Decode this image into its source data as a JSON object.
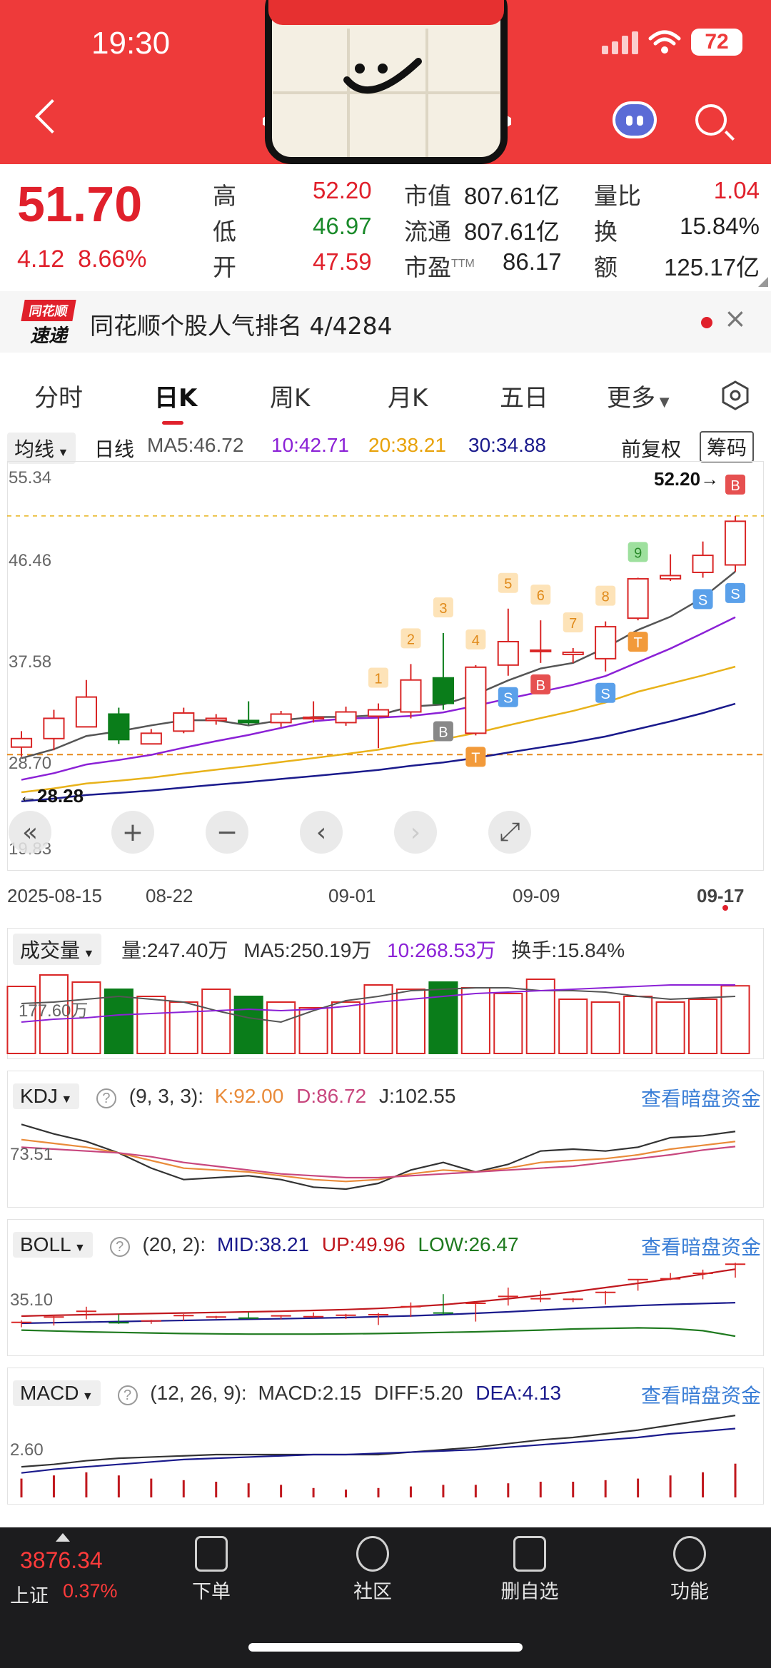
{
  "status_bar": {
    "time": "19:30",
    "battery": "72"
  },
  "quote": {
    "price": "51.70",
    "change": "4.12",
    "change_pct": "8.66%",
    "rows": [
      {
        "l1": "高",
        "v1": "52.20",
        "l2": "市值",
        "v2": "807.61亿",
        "l3": "量比",
        "v3": "1.04"
      },
      {
        "l1": "低",
        "v1": "46.97",
        "l2": "流通",
        "v2": "807.61亿",
        "l3": "换",
        "v3": "15.84%"
      },
      {
        "l1": "开",
        "v1": "47.59",
        "l2": "市盈",
        "v2": "86.17",
        "l3": "额",
        "v3": "125.17亿"
      }
    ],
    "pe_sup": "TTM"
  },
  "banner": {
    "logo_top": "同花顺",
    "logo_bottom": "速递",
    "text": "同花顺个股人气排名 4/4284",
    "close": "×"
  },
  "tabs": [
    "分时",
    "日K",
    "周K",
    "月K",
    "五日",
    "更多"
  ],
  "kline": {
    "selector": "均线",
    "period": "日线",
    "ma5": "MA5:46.72",
    "ma10": "10:42.71",
    "ma20": "20:38.21",
    "ma30": "30:34.88",
    "adjust": "前复权",
    "chips": "筹码",
    "yticks": [
      "55.34",
      "46.46",
      "37.58",
      "28.70",
      "19.83"
    ],
    "high_label": "52.20→",
    "low_label": "←28.28",
    "dates": [
      "2025-08-15",
      "08-22",
      "09-01",
      "09-09",
      "09-17"
    ],
    "nav": [
      "«",
      "+",
      "−",
      "‹",
      "›",
      "⤢"
    ],
    "colors": {
      "up": "#d92626",
      "down": "#0a7d1a",
      "ma5": "#555555",
      "ma10": "#8b21d6",
      "ma20": "#e8b21a",
      "ma30": "#1a1a8c"
    }
  },
  "chart_data": {
    "type": "candlestick",
    "dates": [
      "2025-08-15",
      "08-22",
      "09-01",
      "09-09",
      "09-17"
    ],
    "ylim": [
      19.83,
      55.34
    ],
    "candles": [
      [
        30.5,
        31.3,
        29.6,
        32.0
      ],
      [
        31.3,
        33.2,
        30.2,
        34.0
      ],
      [
        32.4,
        35.2,
        32.4,
        36.8
      ],
      [
        33.6,
        31.2,
        30.8,
        34.2
      ],
      [
        30.8,
        31.8,
        30.8,
        32.2
      ],
      [
        32.0,
        33.7,
        31.8,
        34.2
      ],
      [
        33.0,
        33.2,
        32.6,
        33.6
      ],
      [
        33.0,
        32.8,
        32.6,
        34.8
      ],
      [
        32.8,
        33.6,
        32.4,
        33.9
      ],
      [
        33.2,
        33.3,
        32.8,
        34.8
      ],
      [
        32.8,
        33.8,
        32.5,
        34.3
      ],
      [
        33.4,
        34.0,
        30.4,
        34.6
      ],
      [
        33.8,
        36.8,
        33.2,
        38.3
      ],
      [
        37.0,
        34.6,
        34.0,
        41.2
      ],
      [
        31.8,
        38.0,
        31.6,
        38.2
      ],
      [
        38.2,
        40.4,
        37.2,
        43.5
      ],
      [
        39.6,
        39.6,
        38.4,
        42.4
      ],
      [
        39.2,
        39.4,
        38.4,
        39.8
      ],
      [
        38.8,
        41.8,
        37.6,
        42.3
      ],
      [
        42.6,
        46.3,
        42.4,
        46.4
      ],
      [
        46.3,
        46.6,
        46.1,
        48.6
      ],
      [
        46.9,
        48.5,
        46.4,
        49.8
      ],
      [
        47.6,
        51.7,
        46.97,
        52.2
      ]
    ],
    "markers": [
      {
        "i": 11,
        "text": "1",
        "kind": "num"
      },
      {
        "i": 12,
        "text": "2",
        "kind": "num"
      },
      {
        "i": 13,
        "text": "3",
        "kind": "num"
      },
      {
        "i": 14,
        "text": "4",
        "kind": "num"
      },
      {
        "i": 15,
        "text": "5",
        "kind": "num"
      },
      {
        "i": 16,
        "text": "6",
        "kind": "num"
      },
      {
        "i": 17,
        "text": "7",
        "kind": "num"
      },
      {
        "i": 18,
        "text": "8",
        "kind": "num"
      },
      {
        "i": 19,
        "text": "9",
        "kind": "numg"
      },
      {
        "i": 13,
        "text": "B",
        "kind": "grey"
      },
      {
        "i": 14,
        "text": "T",
        "kind": "org"
      },
      {
        "i": 15,
        "text": "S",
        "kind": "blue"
      },
      {
        "i": 16,
        "text": "B",
        "kind": "red"
      },
      {
        "i": 18,
        "text": "S",
        "kind": "blue"
      },
      {
        "i": 19,
        "text": "T",
        "kind": "org"
      },
      {
        "i": 21,
        "text": "S",
        "kind": "blue"
      },
      {
        "i": 22,
        "text": "B",
        "kind": "red"
      },
      {
        "i": 23,
        "text": "S",
        "kind": "blue"
      }
    ],
    "volume": {
      "values": [
        247,
        255,
        250,
        245,
        240,
        236,
        245,
        240,
        236,
        232,
        236,
        248,
        245,
        250,
        246,
        242,
        252,
        238,
        236,
        240,
        236,
        238,
        247.4
      ],
      "ma5": [
        235,
        236,
        238,
        240,
        238,
        236,
        230,
        225,
        222,
        230,
        237,
        240,
        244,
        245,
        246,
        246,
        244,
        244,
        243,
        240,
        238,
        239,
        240
      ],
      "ma10": [
        222,
        224,
        225,
        227,
        228,
        229,
        230,
        231,
        230,
        231,
        233,
        236,
        238,
        240,
        242,
        243,
        244,
        245,
        246,
        247,
        248,
        248,
        248
      ],
      "ylabel": "177.60万"
    },
    "kdj": {
      "k": [
        94,
        90,
        86,
        80,
        72,
        64,
        62,
        60,
        56,
        52,
        50,
        52,
        58,
        62,
        60,
        64,
        70,
        72,
        74,
        78,
        84,
        88,
        92
      ],
      "d": [
        86,
        84,
        82,
        80,
        76,
        70,
        66,
        62,
        58,
        56,
        54,
        54,
        56,
        58,
        60,
        62,
        64,
        66,
        70,
        74,
        78,
        83,
        86.72
      ],
      "j": [
        110,
        100,
        92,
        80,
        64,
        52,
        54,
        56,
        52,
        44,
        42,
        48,
        62,
        70,
        60,
        68,
        82,
        84,
        82,
        86,
        96,
        98,
        102.55
      ],
      "ylabel": "73.51"
    },
    "boll": {
      "mid": [
        31.0,
        31.2,
        31.4,
        31.6,
        31.8,
        32.0,
        32.2,
        32.4,
        32.6,
        32.8,
        33.0,
        33.3,
        33.6,
        34.0,
        34.5,
        35.0,
        35.6,
        36.2,
        36.7,
        37.2,
        37.6,
        37.9,
        38.21
      ],
      "up": [
        33.5,
        33.8,
        34.0,
        34.2,
        34.4,
        34.6,
        34.8,
        35.0,
        35.2,
        35.5,
        35.8,
        36.2,
        36.8,
        37.5,
        38.5,
        39.6,
        40.8,
        42.0,
        43.5,
        45.0,
        46.5,
        48.2,
        49.96
      ],
      "low": [
        28.6,
        28.3,
        28.0,
        27.8,
        27.6,
        27.4,
        27.3,
        27.2,
        27.2,
        27.2,
        27.3,
        27.4,
        27.6,
        27.8,
        28.0,
        28.3,
        28.6,
        29.0,
        29.2,
        29.4,
        29.2,
        28.4,
        26.47
      ],
      "ylabel": "35.10"
    },
    "macd": {
      "diff": [
        1.0,
        1.2,
        1.5,
        1.7,
        1.8,
        1.9,
        2.0,
        2.0,
        2.0,
        2.0,
        2.0,
        2.0,
        2.2,
        2.4,
        2.6,
        2.9,
        3.2,
        3.4,
        3.7,
        4.0,
        4.4,
        4.8,
        5.2
      ],
      "dea": [
        0.5,
        0.8,
        1.0,
        1.2,
        1.4,
        1.6,
        1.7,
        1.8,
        1.9,
        2.0,
        2.0,
        2.1,
        2.2,
        2.3,
        2.4,
        2.6,
        2.8,
        3.0,
        3.2,
        3.4,
        3.7,
        3.9,
        4.13
      ],
      "hist": [
        1.2,
        1.4,
        1.6,
        1.4,
        1.2,
        1.1,
        1.0,
        0.9,
        0.8,
        0.6,
        0.5,
        0.6,
        0.7,
        0.8,
        0.8,
        0.9,
        1.0,
        1.0,
        1.1,
        1.2,
        1.4,
        1.6,
        2.15
      ],
      "ylabel": "2.60"
    }
  },
  "volume_head": {
    "selector": "成交量",
    "vol": "量:247.40万",
    "ma5": "MA5:250.19万",
    "ma10": "10:268.53万",
    "turnover": "换手:15.84%"
  },
  "kdj_head": {
    "selector": "KDJ",
    "q": "?",
    "params": "(9, 3, 3):",
    "k": "K:92.00",
    "d": "D:86.72",
    "j": "J:102.55",
    "link": "查看暗盘资金"
  },
  "boll_head": {
    "selector": "BOLL",
    "q": "?",
    "params": "(20, 2):",
    "mid": "MID:38.21",
    "up": "UP:49.96",
    "low": "LOW:26.47",
    "link": "查看暗盘资金"
  },
  "macd_head": {
    "selector": "MACD",
    "q": "?",
    "params": "(12, 26, 9):",
    "macd": "MACD:2.15",
    "diff": "DIFF:5.20",
    "dea": "DEA:4.13",
    "link": "查看暗盘资金"
  },
  "bottom": {
    "index_value": "3876.34",
    "index_name": "上证",
    "index_pct": "0.37%",
    "items": [
      "下单",
      "社区",
      "删自选",
      "功能"
    ]
  }
}
